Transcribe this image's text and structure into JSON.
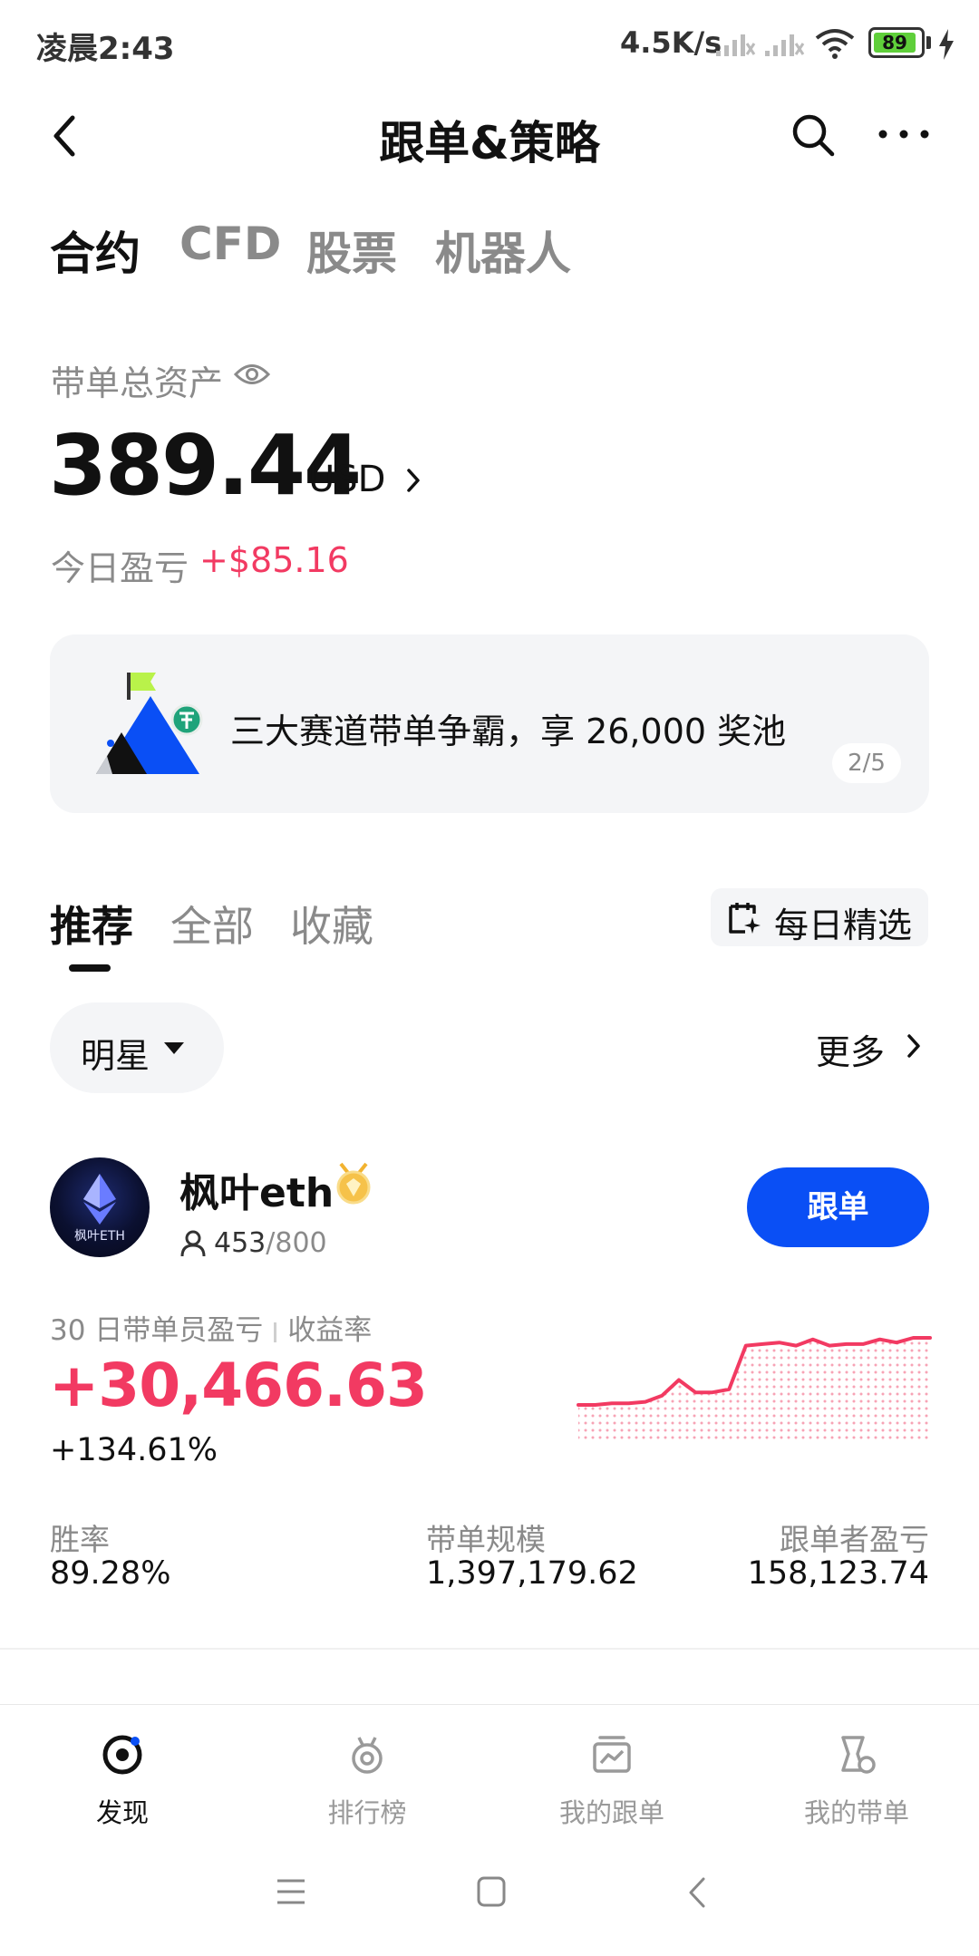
{
  "status_bar": {
    "time": "凌晨2:43",
    "speed": "4.5K/s",
    "battery": "89"
  },
  "header": {
    "title": "跟单&策略"
  },
  "top_tabs": [
    {
      "label": "合约",
      "active": true
    },
    {
      "label": "CFD",
      "active": false
    },
    {
      "label": "股票",
      "active": false
    },
    {
      "label": "机器人",
      "active": false
    }
  ],
  "assets": {
    "label": "带单总资产",
    "value": "389.44",
    "unit": "USD",
    "today_label": "今日盈亏",
    "today_value": "+$85.16"
  },
  "banner": {
    "text": "三大赛道带单争霸，享 26,000 奖池",
    "page": "2/5"
  },
  "sub_tabs": [
    {
      "label": "推荐",
      "active": true
    },
    {
      "label": "全部",
      "active": false
    },
    {
      "label": "收藏",
      "active": false
    }
  ],
  "daily_pick": {
    "label": "每日精选"
  },
  "filter": {
    "selected": "明星",
    "more": "更多"
  },
  "trader": {
    "avatar_text": "枫叶ETH",
    "name": "枫叶eth",
    "followers": "453",
    "followers_max": "/800",
    "follow_label": "跟单",
    "pnl_label": "30 日带单员盈亏",
    "roi_label": "收益率",
    "pnl_value": "+30,466.63",
    "roi_value": "+134.61%",
    "stats": [
      {
        "label": "胜率",
        "value": "89.28%"
      },
      {
        "label": "带单规模",
        "value": "1,397,179.62"
      },
      {
        "label": "跟单者盈亏",
        "value": "158,123.74"
      }
    ]
  },
  "sparkline": {
    "color": "#f23a62",
    "values": [
      2,
      2,
      3,
      3,
      4,
      8,
      18,
      10,
      10,
      12,
      40,
      41,
      42,
      40,
      44,
      40,
      41,
      41,
      44,
      42,
      45,
      45
    ]
  },
  "bottom_nav": [
    {
      "label": "发现",
      "icon": "discover-icon",
      "active": true
    },
    {
      "label": "排行榜",
      "icon": "ranking-icon",
      "active": false
    },
    {
      "label": "我的跟单",
      "icon": "my-copy-icon",
      "active": false
    },
    {
      "label": "我的带单",
      "icon": "my-lead-icon",
      "active": false
    }
  ],
  "colors": {
    "accent": "#0a4ff5",
    "profit": "#f23a62"
  }
}
